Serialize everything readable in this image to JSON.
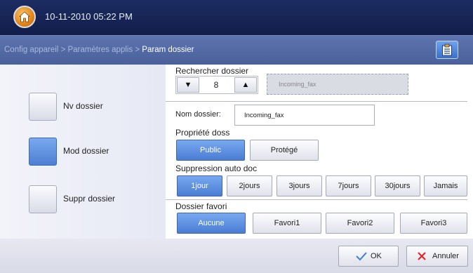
{
  "header": {
    "datetime": "10-11-2010 05:22 PM",
    "home_icon": "home-icon"
  },
  "breadcrumb": {
    "parts": [
      "Config appareil",
      "Paramètres applis"
    ],
    "separator": ">",
    "current": "Param dossier",
    "menu_icon": "clipboard-list-icon"
  },
  "left_actions": [
    {
      "label": "Nv dossier",
      "selected": false
    },
    {
      "label": "Mod dossier",
      "selected": true
    },
    {
      "label": "Suppr dossier",
      "selected": false
    }
  ],
  "search": {
    "label": "Rechercher dossier",
    "value": "8",
    "folder": "Incoming_fax",
    "down_icon": "triangle-down-icon",
    "up_icon": "triangle-up-icon"
  },
  "name": {
    "label": "Nom dossier:",
    "value": "Incoming_fax"
  },
  "property": {
    "label": "Propriété doss",
    "options": [
      "Public",
      "Protégé"
    ],
    "selected": "Public"
  },
  "auto_delete": {
    "label": "Suppression auto doc",
    "options": [
      "1jour",
      "2jours",
      "3jours",
      "7jours",
      "30jours",
      "Jamais"
    ],
    "selected": "1jour"
  },
  "favorite": {
    "label": "Dossier favori",
    "options": [
      "Aucune",
      "Favori1",
      "Favori2",
      "Favori3"
    ],
    "selected": "Aucune"
  },
  "footer": {
    "ok": "OK",
    "cancel": "Annuler",
    "ok_icon": "checkmark-icon",
    "cancel_icon": "x-cross-icon"
  },
  "colors": {
    "header_bg": "#162456",
    "breadcrumb_bg": "#5469a6",
    "accent_blue": "#4a7dd3",
    "cancel_red": "#e0262b",
    "ok_check": "#3b7fd9"
  }
}
